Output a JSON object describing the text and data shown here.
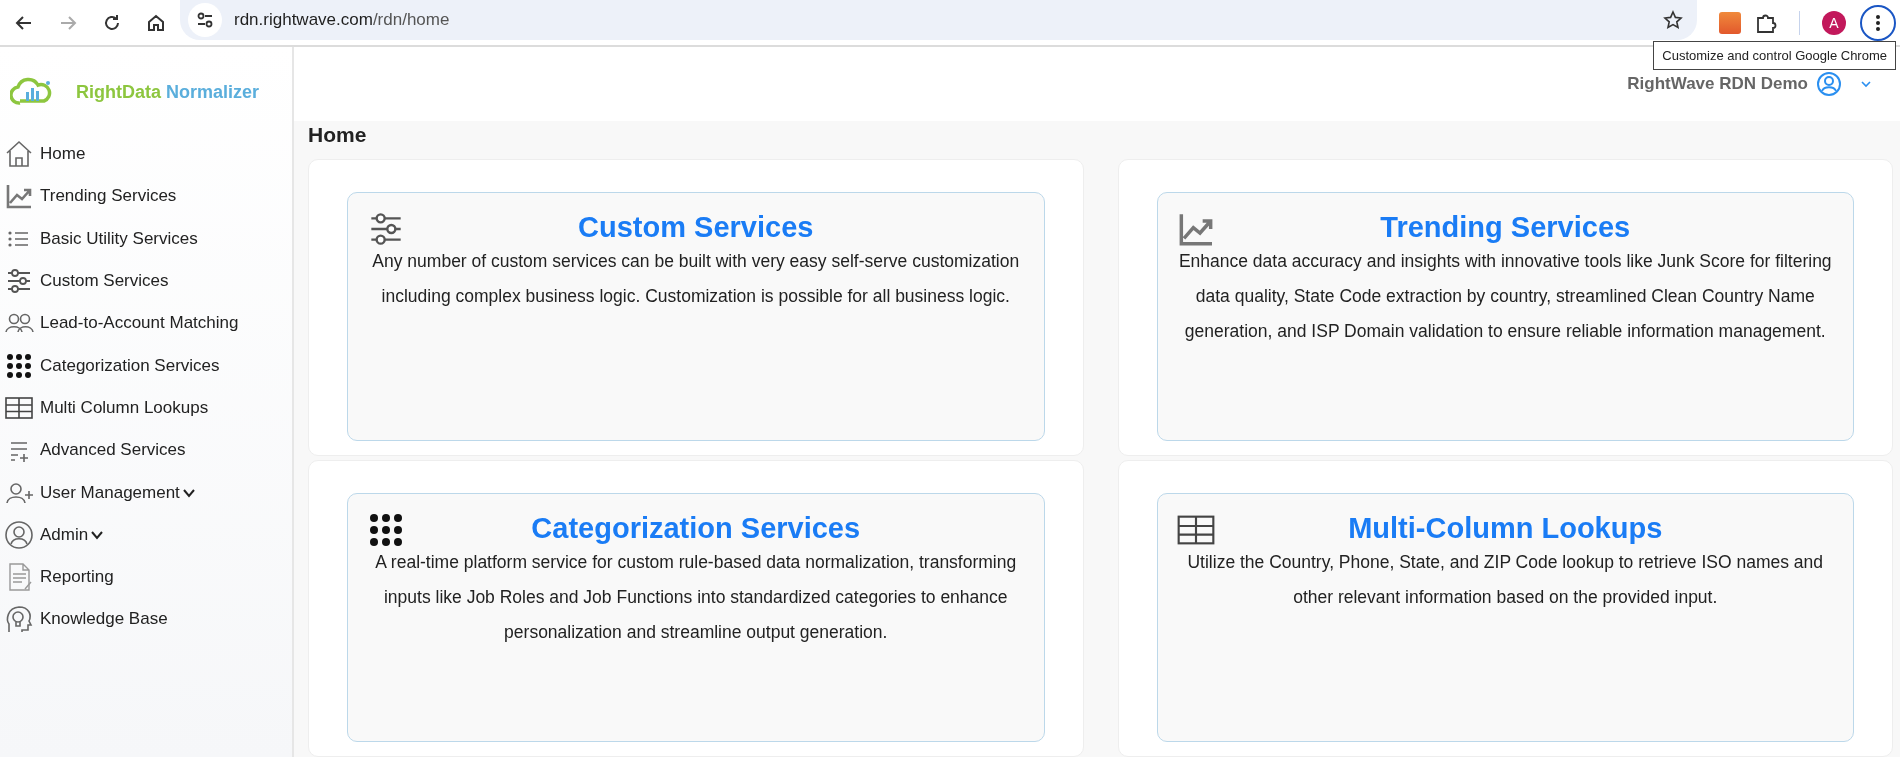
{
  "browser": {
    "url_host": "rdn.rightwave.com",
    "url_path": "/rdn/home",
    "profile_initial": "A",
    "tooltip": "Customize and control Google Chrome"
  },
  "sidebar": {
    "logo_brand": "RightData",
    "logo_product": "Normalizer",
    "items": [
      {
        "label": "Home",
        "kind": "home",
        "has_submenu": false
      },
      {
        "label": "Trending Services",
        "kind": "trend",
        "has_submenu": false
      },
      {
        "label": "Basic Utility Services",
        "kind": "list",
        "has_submenu": false
      },
      {
        "label": "Custom Services",
        "kind": "sliders",
        "has_submenu": false
      },
      {
        "label": "Lead-to-Account Matching",
        "kind": "people",
        "has_submenu": false
      },
      {
        "label": "Categorization Services",
        "kind": "dots",
        "has_submenu": false
      },
      {
        "label": "Multi Column Lookups",
        "kind": "table",
        "has_submenu": false
      },
      {
        "label": "Advanced Services",
        "kind": "addlist",
        "has_submenu": false
      },
      {
        "label": "User Management",
        "kind": "useradd",
        "has_submenu": true
      },
      {
        "label": "Admin",
        "kind": "usercircle",
        "has_submenu": true
      },
      {
        "label": "Reporting",
        "kind": "report",
        "has_submenu": false
      },
      {
        "label": "Knowledge Base",
        "kind": "bulb",
        "has_submenu": false
      }
    ]
  },
  "header": {
    "user": "RightWave RDN Demo"
  },
  "page_title": "Home",
  "cards": [
    {
      "title": "Custom Services",
      "kind": "sliders",
      "description": "Any number of custom services can be built with very easy self-serve customization including complex business logic. Customization is possible for all business logic."
    },
    {
      "title": "Trending Services",
      "kind": "trend",
      "description": "Enhance data accuracy and insights with innovative tools like Junk Score for filtering data quality, State Code extraction by country, streamlined Clean Country Name generation, and ISP Domain validation to ensure reliable information management."
    },
    {
      "title": "Categorization Services",
      "kind": "dots",
      "description": "A real-time platform service for custom rule-based data normalization, transforming inputs like Job Roles and Job Functions into standardized categories to enhance personalization and streamline output generation."
    },
    {
      "title": "Multi-Column Lookups",
      "kind": "table",
      "description": "Utilize the Country, Phone, State, and ZIP Code lookup to retrieve ISO names and other relevant information based on the provided input."
    }
  ]
}
